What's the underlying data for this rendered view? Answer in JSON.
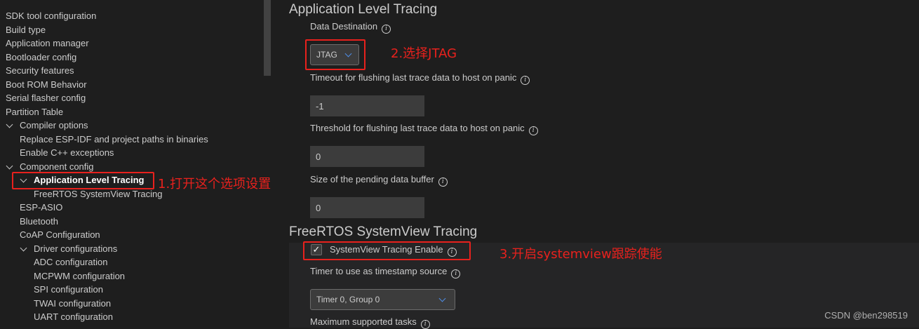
{
  "tree": {
    "items": [
      {
        "label": "SDK tool configuration"
      },
      {
        "label": "Build type"
      },
      {
        "label": "Application manager"
      },
      {
        "label": "Bootloader config"
      },
      {
        "label": "Security features"
      },
      {
        "label": "Boot ROM Behavior"
      },
      {
        "label": "Serial flasher config"
      },
      {
        "label": "Partition Table"
      },
      {
        "label": "Compiler options",
        "expanded": true
      },
      {
        "label": "Replace ESP-IDF and project paths in binaries"
      },
      {
        "label": "Enable C++ exceptions"
      },
      {
        "label": "Component config",
        "expanded": true
      },
      {
        "label": "Application Level Tracing",
        "expanded": true,
        "selected": true
      },
      {
        "label": "FreeRTOS SystemView Tracing"
      },
      {
        "label": "ESP-ASIO"
      },
      {
        "label": "Bluetooth"
      },
      {
        "label": "CoAP Configuration"
      },
      {
        "label": "Driver configurations",
        "expanded": true
      },
      {
        "label": "ADC configuration"
      },
      {
        "label": "MCPWM configuration"
      },
      {
        "label": "SPI configuration"
      },
      {
        "label": "TWAI configuration"
      },
      {
        "label": "UART configuration"
      }
    ]
  },
  "panel": {
    "app_tracing": {
      "title": "Application Level Tracing",
      "data_destination": {
        "label": "Data Destination",
        "value": "JTAG"
      },
      "timeout": {
        "label": "Timeout for flushing last trace data to host on panic",
        "value": "-1"
      },
      "threshold": {
        "label": "Threshold for flushing last trace data to host on panic",
        "value": "0"
      },
      "pending_buffer": {
        "label": "Size of the pending data buffer",
        "value": "0"
      }
    },
    "sysview": {
      "title": "FreeRTOS SystemView Tracing",
      "enable": {
        "label": "SystemView Tracing Enable",
        "checked": true,
        "check_glyph": "✓"
      },
      "timer": {
        "label": "Timer to use as timestamp source",
        "value": "Timer 0, Group 0"
      },
      "max_tasks": {
        "label": "Maximum supported tasks"
      }
    },
    "info_glyph": "i"
  },
  "annotations": {
    "step1": "1.打开这个选项设置",
    "step2": "2.选择JTAG",
    "step3": "3.开启systemview跟踪使能",
    "color": "#e8211d"
  },
  "watermark": "CSDN @ben298519",
  "colors": {
    "background": "#1e1e1e",
    "input_bg": "#3c3c3c",
    "text": "#cccccc",
    "accent_chevron": "#4f8de6"
  }
}
